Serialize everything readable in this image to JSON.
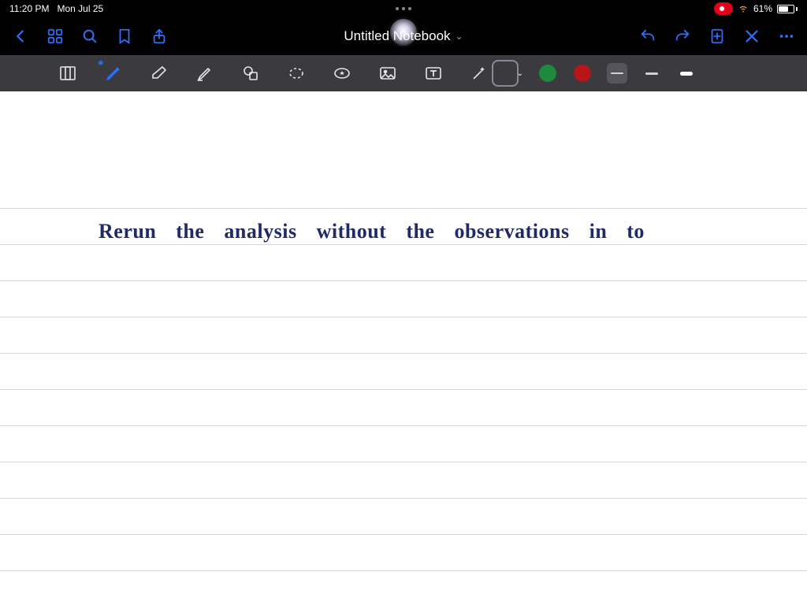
{
  "status": {
    "time": "11:20 PM",
    "date": "Mon Jul 25",
    "battery_pct": "61%"
  },
  "header": {
    "title": "Untitled Notebook"
  },
  "colors": {
    "blue": "#1f2fb5",
    "green": "#1e8a3e",
    "red": "#b6161a"
  },
  "note": {
    "line1": "Rerun  the  analysis  without  the  observations  in   to"
  }
}
